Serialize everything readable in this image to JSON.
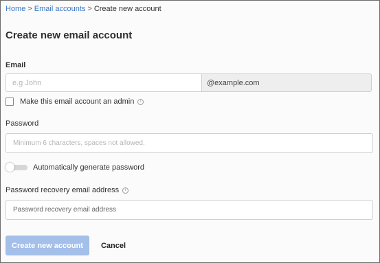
{
  "breadcrumb": {
    "home": "Home",
    "email_accounts": "Email accounts",
    "current": "Create new account",
    "separator": ">"
  },
  "page": {
    "title": "Create new email account"
  },
  "email": {
    "label": "Email",
    "placeholder": "e.g John",
    "value": "",
    "domain": "@example.com"
  },
  "admin_checkbox": {
    "label": "Make this email account an admin",
    "checked": false,
    "info_icon": "info-icon"
  },
  "password": {
    "label": "Password",
    "placeholder": "Minimum 6 characters, spaces not allowed.",
    "value": ""
  },
  "auto_generate": {
    "label": "Automatically generate password",
    "enabled": false
  },
  "recovery": {
    "label": "Password recovery email address",
    "placeholder": "Password recovery email address",
    "value": "",
    "info_icon": "info-icon"
  },
  "actions": {
    "create_label": "Create new account",
    "cancel_label": "Cancel"
  },
  "colors": {
    "link": "#3a78c9",
    "primary_button_disabled": "#a3bfea",
    "addon_background": "#eeeeee"
  }
}
